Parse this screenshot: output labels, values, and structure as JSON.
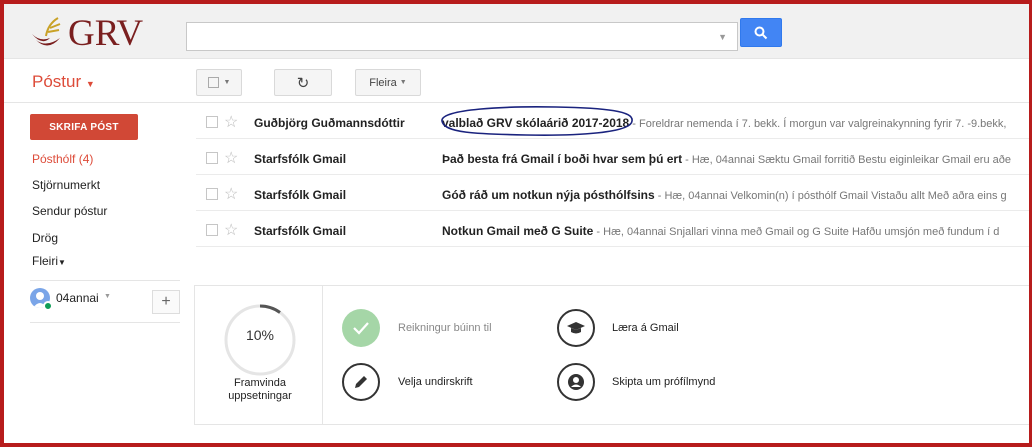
{
  "brand": {
    "logo_text": "GRV"
  },
  "search": {
    "placeholder": "",
    "value": ""
  },
  "toolbar": {
    "mail_label": "Póstur",
    "more_label": "Fleira"
  },
  "sidebar": {
    "compose_label": "SKRIFA PÓST",
    "items": [
      {
        "label": "Pósthólf (4)",
        "active": true
      },
      {
        "label": "Stjörnumerkt"
      },
      {
        "label": "Sendur póstur"
      },
      {
        "label": "Drög"
      },
      {
        "label": "Fleiri"
      }
    ],
    "account_name": "04annai"
  },
  "emails": [
    {
      "sender": "Guðbjörg Guðmannsdóttir",
      "subject": "valblað GRV skólaárið 2017-2018",
      "snippet": " - Foreldrar nemenda í 7. bekk. Í morgun var valgreinakynning fyrir 7. -9.bekk,"
    },
    {
      "sender": "Starfsfólk Gmail",
      "subject": "Það besta frá Gmail í boði hvar sem þú ert",
      "snippet": " - Hæ, 04annai Sæktu Gmail forritið Bestu eiginleikar Gmail eru aðe"
    },
    {
      "sender": "Starfsfólk Gmail",
      "subject": "Góð ráð um notkun nýja pósthólfsins",
      "snippet": " - Hæ, 04annai Velkomin(n) í pósthólf Gmail Vistaðu allt Með aðra eins g"
    },
    {
      "sender": "Starfsfólk Gmail",
      "subject": "Notkun Gmail með G Suite",
      "snippet": " - Hæ, 04annai Snjallari vinna með Gmail og G Suite Hafðu umsjón með fundum í d"
    }
  ],
  "setup": {
    "progress_text": "10%",
    "progress_value": 0.1,
    "progress_label": "Framvinda uppsetningar",
    "tasks": [
      {
        "label": "Reikningur búinn til",
        "icon": "check-icon",
        "done": true
      },
      {
        "label": "Læra á Gmail",
        "icon": "graduation-cap-icon",
        "done": false
      },
      {
        "label": "Velja undirskrift",
        "icon": "pen-icon",
        "done": false
      },
      {
        "label": "Skipta um prófílmynd",
        "icon": "profile-icon",
        "done": false
      }
    ]
  },
  "colors": {
    "frame": "#b71c1c",
    "compose": "#d14836",
    "accent_red": "#dd4b39",
    "search_blue": "#4285f4",
    "annotation_circle": "#1a237e"
  }
}
